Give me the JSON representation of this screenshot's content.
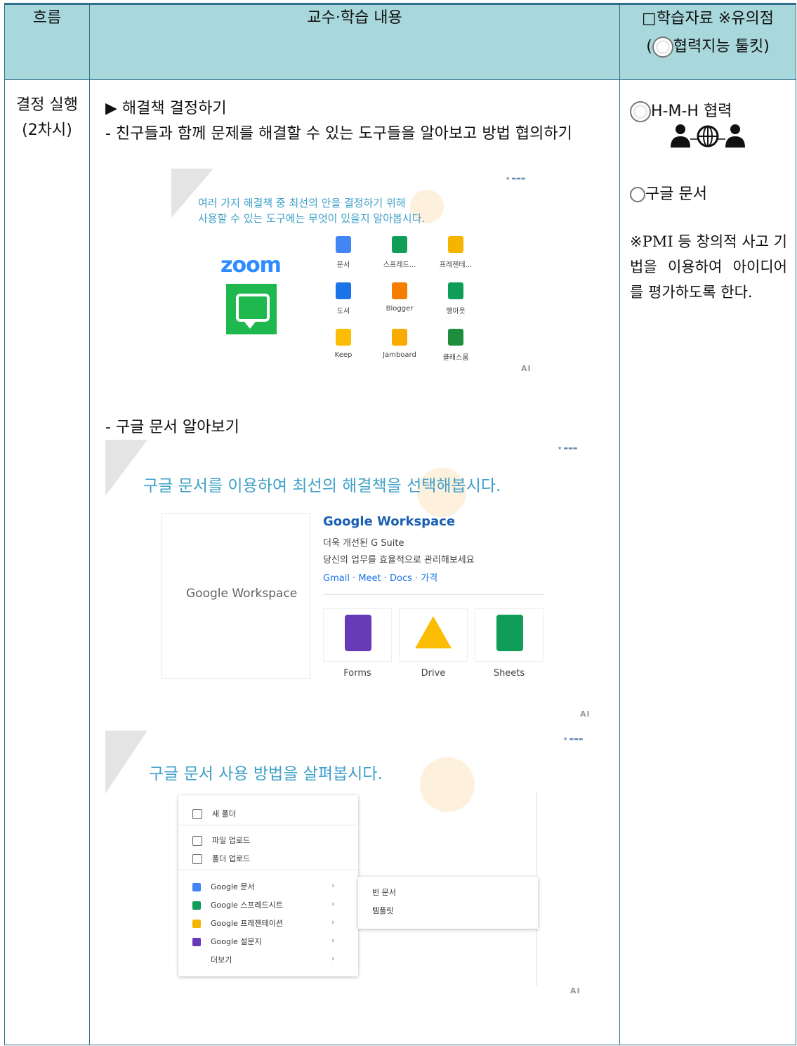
{
  "header": {
    "col_flow": "흐름",
    "col_content": "교수·학습 내용",
    "col_materials_line1": "□학습자료 ※유의점",
    "col_materials_line2_pre": "(",
    "col_materials_line2_post": "협력지능 툴킷)"
  },
  "stage": {
    "line1": "결정 실행",
    "line2": "(2차시)"
  },
  "content": {
    "heading": "▶ 해결책 결정하기",
    "bullet1": "- 친구들과 함께 문제를 해결할 수 있는 도구들을 알아보고 방법 협의하기",
    "bullet2": "- 구글 문서 알아보기"
  },
  "slide1": {
    "title_line1": "여러 가지 해결책 중 최선의 안을 결정하기 위해",
    "title_line2": "사용할 수 있는 도구에는 무엇이 있을지 알아봅시다.",
    "zoom_label": "zoom",
    "apps": [
      {
        "label": "문서",
        "color": "#4285f4"
      },
      {
        "label": "스프레드...",
        "color": "#0f9d58"
      },
      {
        "label": "프레젠테...",
        "color": "#f4b400"
      },
      {
        "label": "도서",
        "color": "#1a73e8"
      },
      {
        "label": "Blogger",
        "color": "#f57d00"
      },
      {
        "label": "행아웃",
        "color": "#0f9d58"
      },
      {
        "label": "Keep",
        "color": "#fbbc04"
      },
      {
        "label": "Jamboard",
        "color": "#f9ab00"
      },
      {
        "label": "클래스룸",
        "color": "#1e8e3e"
      }
    ],
    "ai_mark": "AI"
  },
  "slide2": {
    "title": "구글 문서를 이용하여 최선의 해결책을 선택해봅시다.",
    "logo_text": "Google Workspace",
    "card_title": "Google Workspace",
    "card_line1": "더욱 개선된 G Suite",
    "card_line2": "당신의 업무를 효율적으로 관리해보세요",
    "card_links": "Gmail · Meet · Docs · 가격",
    "tiles": [
      {
        "label": "Forms",
        "icon": "forms-icon"
      },
      {
        "label": "Drive",
        "icon": "drive-icon"
      },
      {
        "label": "Sheets",
        "icon": "sheets-icon"
      }
    ],
    "ai_mark": "AI"
  },
  "slide3": {
    "title": "구글 문서 사용 방법을 살펴봅시다.",
    "menu": [
      {
        "label": "새 폴더",
        "icon": "new-folder-icon"
      },
      {
        "label": "파일 업로드",
        "icon": "file-upload-icon"
      },
      {
        "label": "폴더 업로드",
        "icon": "folder-upload-icon"
      },
      {
        "label": "Google 문서",
        "icon": "docs-icon",
        "color": "#4285f4"
      },
      {
        "label": "Google 스프레드시트",
        "icon": "sheets-icon",
        "color": "#0f9d58"
      },
      {
        "label": "Google 프레젠테이션",
        "icon": "slides-icon",
        "color": "#f4b400"
      },
      {
        "label": "Google 설문지",
        "icon": "forms-icon",
        "color": "#673ab7"
      },
      {
        "label": "더보기",
        "icon": ""
      }
    ],
    "submenu": [
      "빈 문서",
      "템플릿"
    ],
    "ai_mark": "AI"
  },
  "materials": {
    "item1": "H-M-H 협력",
    "item2": "구글 문서",
    "note": "※PMI 등 창의적 사고 기법을 이용하여 아이디어를 평가하도록 한다."
  },
  "colors": {
    "header_bg": "#a8d7dc",
    "border": "#2e6f8c",
    "slide_title": "#3fa0c9"
  }
}
